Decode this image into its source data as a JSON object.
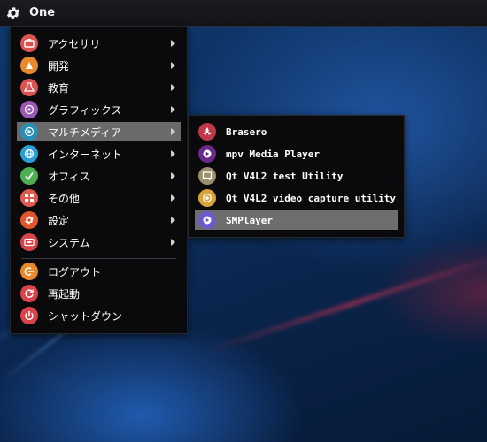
{
  "panel": {
    "label": "One"
  },
  "menu": {
    "items": [
      {
        "label": "アクセサリ",
        "icon": "accessories-icon",
        "color": "#d9534f",
        "has_submenu": true
      },
      {
        "label": "開発",
        "icon": "development-icon",
        "color": "#e8892b",
        "has_submenu": true
      },
      {
        "label": "教育",
        "icon": "education-icon",
        "color": "#d9534f",
        "has_submenu": true
      },
      {
        "label": "グラフィックス",
        "icon": "graphics-icon",
        "color": "#9b59b6",
        "has_submenu": true
      },
      {
        "label": "マルチメディア",
        "icon": "multimedia-icon",
        "color": "#2a8fb8",
        "has_submenu": true,
        "selected": true
      },
      {
        "label": "インターネット",
        "icon": "internet-icon",
        "color": "#2a9fd6",
        "has_submenu": true
      },
      {
        "label": "オフィス",
        "icon": "office-icon",
        "color": "#4caf50",
        "has_submenu": true
      },
      {
        "label": "その他",
        "icon": "other-icon",
        "color": "#e05a4f",
        "has_submenu": true
      },
      {
        "label": "設定",
        "icon": "settings-icon",
        "color": "#e0562a",
        "has_submenu": true
      },
      {
        "label": "システム",
        "icon": "system-icon",
        "color": "#d9434a",
        "has_submenu": true
      }
    ],
    "actions": [
      {
        "label": "ログアウト",
        "icon": "logout-icon",
        "color": "#e8892b"
      },
      {
        "label": "再起動",
        "icon": "restart-icon",
        "color": "#d9434a"
      },
      {
        "label": "シャットダウン",
        "icon": "shutdown-icon",
        "color": "#d9434a"
      }
    ]
  },
  "submenu": {
    "items": [
      {
        "label": "Brasero",
        "icon": "brasero-icon",
        "color": "#c0394b"
      },
      {
        "label": "mpv Media Player",
        "icon": "mpv-icon",
        "color": "#6a2a8a"
      },
      {
        "label": "Qt V4L2 test Utility",
        "icon": "qt-v4l2-test-icon",
        "color": "#9a8f6a"
      },
      {
        "label": "Qt V4L2 video capture utility",
        "icon": "qt-v4l2-capture-icon",
        "color": "#d6a43a"
      },
      {
        "label": "SMPlayer",
        "icon": "smplayer-icon",
        "color": "#6b5acd",
        "selected": true
      }
    ]
  }
}
